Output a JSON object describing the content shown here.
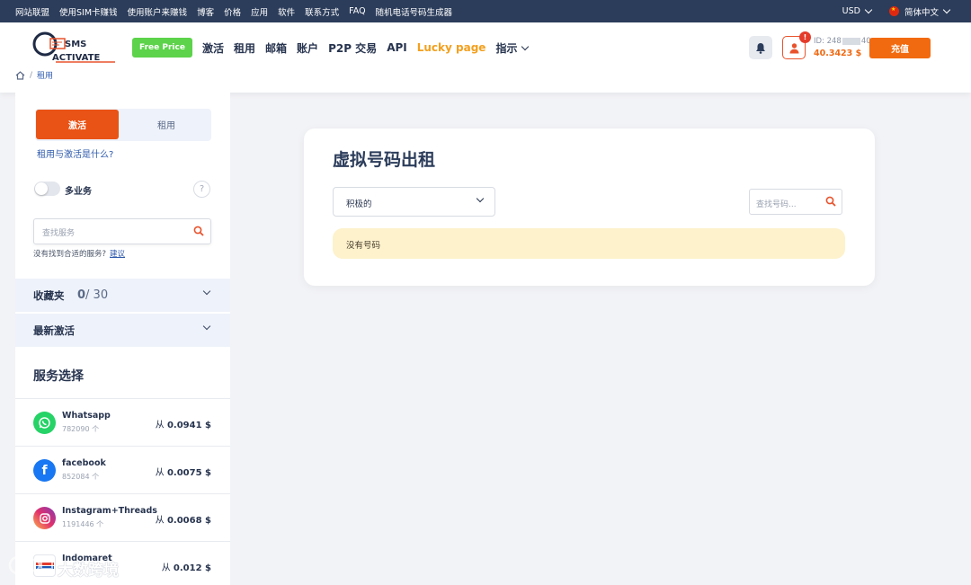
{
  "topbar": {
    "links": [
      "网站联盟",
      "使用SIM卡赚钱",
      "使用账户来赚钱",
      "博客",
      "价格",
      "应用",
      "软件",
      "联系方式",
      "FAQ",
      "随机电话号码生成器"
    ],
    "currency": "USD",
    "language": "简体中文"
  },
  "header": {
    "logo_text_top": "SMS",
    "logo_text_bottom": "ACTIVATE",
    "free_price": "Free Price",
    "nav": [
      "激活",
      "租用",
      "邮箱",
      "账户",
      "P2P 交易",
      "API"
    ],
    "lucky": "Lucky page",
    "guide": "指示",
    "notification_badge": "!",
    "account_id_prefix": "ID: 248",
    "account_id_suffix": "40",
    "balance": "40.3423 $",
    "topup": "充值"
  },
  "breadcrumb": {
    "separator": "/",
    "current": "租用"
  },
  "sidebar": {
    "activation_tab": "激活",
    "rent_tab": "租用",
    "what_link": "租用与激活是什么?",
    "multi_service": "多业务",
    "help": "?",
    "search_placeholder": "查找服务",
    "not_found": "没有找到合适的服务?",
    "suggest": "建议",
    "favorites": {
      "label": "收藏夹",
      "count": "0",
      "total": "/ 30"
    },
    "recent": "最新激活",
    "services_title": "服务选择",
    "price_prefix": "从",
    "services": [
      {
        "name": "Whatsapp",
        "count": "782090 个",
        "price": "0.0941 $",
        "color": "#25d366"
      },
      {
        "name": "facebook",
        "count": "852084 个",
        "price": "0.0075 $",
        "color": "#1877f2"
      },
      {
        "name": "Instagram+Threads",
        "count": "1191446 个",
        "price": "0.0068 $",
        "color": "#d6249f"
      },
      {
        "name": "Indomaret",
        "count": "",
        "price": "0.012 $",
        "color": "#e23b2e"
      }
    ]
  },
  "main": {
    "title": "虚拟号码出租",
    "status_value": "积极的",
    "number_search_placeholder": "查找号码...",
    "empty_message": "没有号码"
  },
  "watermark": "大数跨境",
  "colors": {
    "accent": "#f26a0f",
    "topbar": "#2c3d5b",
    "free_price": "#5cd34a",
    "lucky": "#f3a01e"
  }
}
